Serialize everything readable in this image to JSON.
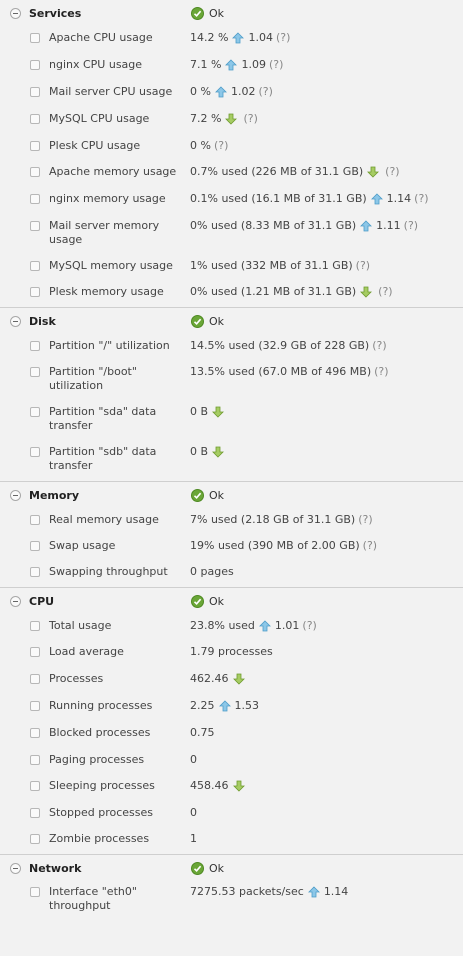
{
  "colors": {
    "background": "#f2f2f2",
    "ok_green": "#6aa637",
    "arrow_up_blue": "#6ab4dc",
    "arrow_down_green": "#8ab84a"
  },
  "sections": [
    {
      "title": "Services",
      "status": "Ok",
      "items": [
        {
          "label": "Apache CPU usage",
          "value": "14.2 %",
          "trend": "up",
          "trend_value": "1.04",
          "help": "(?)"
        },
        {
          "label": "nginx CPU usage",
          "value": "7.1 %",
          "trend": "up",
          "trend_value": "1.09",
          "help": "(?)"
        },
        {
          "label": "Mail server CPU usage",
          "value": "0 %",
          "trend": "up",
          "trend_value": "1.02",
          "help": "(?)"
        },
        {
          "label": "MySQL CPU usage",
          "value": "7.2 %",
          "trend": "down",
          "trend_value": "",
          "help": "(?)"
        },
        {
          "label": "Plesk CPU usage",
          "value": "0 %",
          "trend": "",
          "trend_value": "",
          "help": "(?)"
        },
        {
          "label": "Apache memory usage",
          "value": "0.7% used (226 MB of 31.1 GB)",
          "trend": "down",
          "trend_value": "",
          "help": "(?)"
        },
        {
          "label": "nginx memory usage",
          "value": "0.1% used (16.1 MB of 31.1 GB)",
          "trend": "up",
          "trend_value": "1.14",
          "help": "(?)"
        },
        {
          "label": "Mail server memory usage",
          "value": "0% used (8.33 MB of 31.1 GB)",
          "trend": "up",
          "trend_value": "1.11",
          "help": "(?)"
        },
        {
          "label": "MySQL memory usage",
          "value": "1% used (332 MB of 31.1 GB)",
          "trend": "",
          "trend_value": "",
          "help": "(?)"
        },
        {
          "label": "Plesk memory usage",
          "value": "0% used (1.21 MB of 31.1 GB)",
          "trend": "down",
          "trend_value": "",
          "help": "(?)"
        }
      ]
    },
    {
      "title": "Disk",
      "status": "Ok",
      "items": [
        {
          "label": "Partition \"/\" utilization",
          "value": "14.5% used (32.9 GB of 228 GB)",
          "trend": "",
          "trend_value": "",
          "help": "(?)"
        },
        {
          "label": "Partition \"/boot\" utilization",
          "value": "13.5% used (67.0 MB of 496 MB)",
          "trend": "",
          "trend_value": "",
          "help": "(?)"
        },
        {
          "label": "Partition \"sda\" data transfer",
          "value": "0 B",
          "trend": "down",
          "trend_value": "",
          "help": ""
        },
        {
          "label": "Partition \"sdb\" data transfer",
          "value": "0 B",
          "trend": "down",
          "trend_value": "",
          "help": ""
        }
      ]
    },
    {
      "title": "Memory",
      "status": "Ok",
      "items": [
        {
          "label": "Real memory usage",
          "value": "7% used (2.18 GB of 31.1 GB)",
          "trend": "",
          "trend_value": "",
          "help": "(?)"
        },
        {
          "label": "Swap usage",
          "value": "19% used (390 MB of 2.00 GB)",
          "trend": "",
          "trend_value": "",
          "help": "(?)"
        },
        {
          "label": "Swapping throughput",
          "value": "0 pages",
          "trend": "",
          "trend_value": "",
          "help": ""
        }
      ]
    },
    {
      "title": "CPU",
      "status": "Ok",
      "items": [
        {
          "label": "Total usage",
          "value": "23.8% used",
          "trend": "up",
          "trend_value": "1.01",
          "help": "(?)"
        },
        {
          "label": "Load average",
          "value": "1.79 processes",
          "trend": "",
          "trend_value": "",
          "help": ""
        },
        {
          "label": "Processes",
          "value": "462.46",
          "trend": "down",
          "trend_value": "",
          "help": ""
        },
        {
          "label": "Running processes",
          "value": "2.25",
          "trend": "up",
          "trend_value": "1.53",
          "help": ""
        },
        {
          "label": "Blocked processes",
          "value": "0.75",
          "trend": "",
          "trend_value": "",
          "help": ""
        },
        {
          "label": "Paging processes",
          "value": "0",
          "trend": "",
          "trend_value": "",
          "help": ""
        },
        {
          "label": "Sleeping processes",
          "value": "458.46",
          "trend": "down",
          "trend_value": "",
          "help": ""
        },
        {
          "label": "Stopped processes",
          "value": "0",
          "trend": "",
          "trend_value": "",
          "help": ""
        },
        {
          "label": "Zombie processes",
          "value": "1",
          "trend": "",
          "trend_value": "",
          "help": ""
        }
      ]
    },
    {
      "title": "Network",
      "status": "Ok",
      "items": [
        {
          "label": "Interface \"eth0\" throughput",
          "value": "7275.53 packets/sec",
          "trend": "up",
          "trend_value": "1.14",
          "help": ""
        }
      ]
    }
  ]
}
